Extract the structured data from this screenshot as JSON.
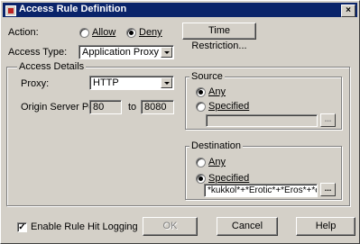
{
  "window": {
    "title": "Access Rule Definition",
    "close_label": "×"
  },
  "action": {
    "label": "Action:",
    "allow_label": "Allow",
    "deny_label": "Deny",
    "selected": "Deny"
  },
  "time_restriction_button": "Time Restriction...",
  "access_type": {
    "label": "Access Type:",
    "value": "Application Proxy"
  },
  "access_details": {
    "group_title": "Access Details",
    "proxy_label": "Proxy:",
    "proxy_value": "HTTP",
    "port_label": "Origin Server Port:",
    "port_from": "80",
    "to_label": "to",
    "port_to": "8080"
  },
  "source": {
    "group_title": "Source",
    "any_label": "Any",
    "specified_label": "Specified",
    "selected": "Any",
    "specified_value": "",
    "browse_label": "..."
  },
  "destination": {
    "group_title": "Destination",
    "any_label": "Any",
    "specified_label": "Specified",
    "selected": "Specified",
    "specified_value": "*kukkol*+*Erotic*+*Eros*+*erotika",
    "browse_label": "..."
  },
  "logging": {
    "label": "Enable Rule Hit Logging",
    "checked": true,
    "check_mark": "✓"
  },
  "buttons": {
    "ok": "OK",
    "cancel": "Cancel",
    "help": "Help"
  },
  "colors": {
    "titlebar": "#0a246a",
    "face": "#d4d0c8"
  }
}
